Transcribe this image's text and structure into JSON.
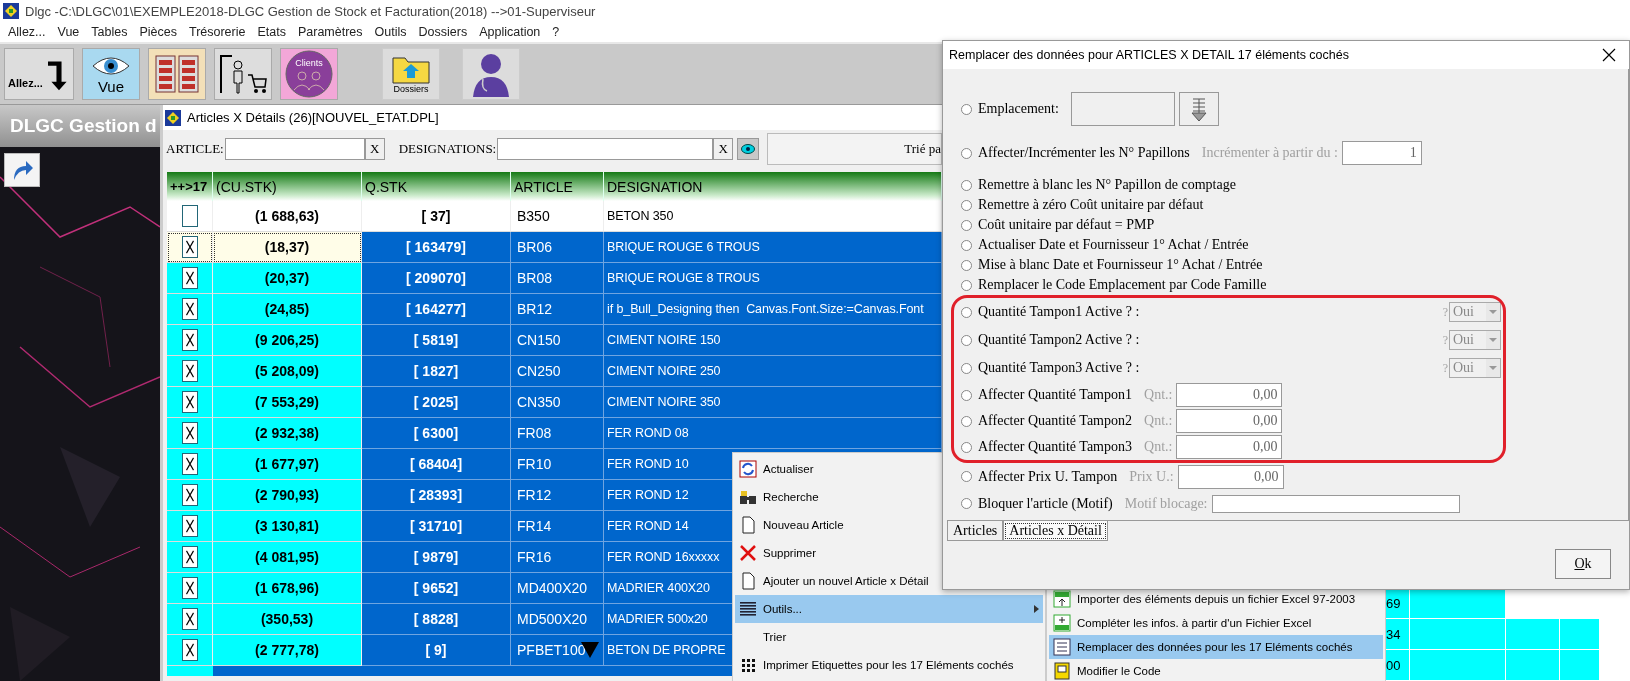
{
  "window": {
    "title": "Dlgc -C:\\DLGC\\01\\EXEMPLE2018-DLGC Gestion de Stock et Facturation(2018) -->01-Superviseur"
  },
  "menu": [
    "Allez...",
    "Vue",
    "Tables",
    "Pièces",
    "Trésorerie",
    "Etats",
    "Paramètres",
    "Outils",
    "Dossiers",
    "Application",
    "?"
  ],
  "toolbar": [
    {
      "kind": "allez",
      "label": "Allez..."
    },
    {
      "kind": "vue",
      "label": "Vue"
    },
    {
      "kind": "tables"
    },
    {
      "kind": "stock"
    },
    {
      "kind": "clients",
      "label": "Clients"
    },
    {
      "kind": "dossiers",
      "label": "Dossiers"
    },
    {
      "kind": "user"
    }
  ],
  "side_panel": {
    "title": "DLGC Gestion d"
  },
  "articles_window": {
    "title": "Articles X Détails (26)[NOUVEL_ETAT.DPL]",
    "filters": [
      {
        "label": "ARTICLE:",
        "clear": "X"
      },
      {
        "label": "DESIGNATIONS:",
        "clear": "X"
      }
    ],
    "sort_button": "Trié pa",
    "columns": [
      "++>17",
      "(CU.STK)",
      "Q.STK",
      "ARTICLE",
      "DESIGNATION"
    ],
    "rows": [
      {
        "checked": false,
        "focused": false,
        "cost": "(1 688,63)",
        "qty": "[ 37]",
        "article": "B350",
        "designation": "BETON 350"
      },
      {
        "checked": true,
        "focused": true,
        "cost": "(18,37)",
        "qty": "[ 163479]",
        "article": "BR06",
        "designation": "BRIQUE ROUGE 6 TROUS"
      },
      {
        "checked": true,
        "focused": false,
        "cost": "(20,37)",
        "qty": "[ 209070]",
        "article": "BR08",
        "designation": "BRIQUE ROUGE 8 TROUS"
      },
      {
        "checked": true,
        "focused": false,
        "cost": "(24,85)",
        "qty": "[ 164277]",
        "article": "BR12",
        "designation": "if b_Bull_Designing then  Canvas.Font.Size:=Canvas.Font"
      },
      {
        "checked": true,
        "focused": false,
        "cost": "(9 206,25)",
        "qty": "[ 5819]",
        "article": "CN150",
        "designation": "CIMENT NOIRE 150"
      },
      {
        "checked": true,
        "focused": false,
        "cost": "(5 208,09)",
        "qty": "[ 1827]",
        "article": "CN250",
        "designation": "CIMENT NOIRE 250"
      },
      {
        "checked": true,
        "focused": false,
        "cost": "(7 553,29)",
        "qty": "[ 2025]",
        "article": "CN350",
        "designation": "CIMENT NOIRE 350"
      },
      {
        "checked": true,
        "focused": false,
        "cost": "(2 932,38)",
        "qty": "[ 6300]",
        "article": "FR08",
        "designation": "FER ROND 08"
      },
      {
        "checked": true,
        "focused": false,
        "cost": "(1 677,97)",
        "qty": "[ 68404]",
        "article": "FR10",
        "designation": "FER ROND 10"
      },
      {
        "checked": true,
        "focused": false,
        "cost": "(2 790,93)",
        "qty": "[ 28393]",
        "article": "FR12",
        "designation": "FER ROND 12"
      },
      {
        "checked": true,
        "focused": false,
        "cost": "(3 130,81)",
        "qty": "[ 31710]",
        "article": "FR14",
        "designation": "FER ROND 14"
      },
      {
        "checked": true,
        "focused": false,
        "cost": "(4 081,95)",
        "qty": "[ 9879]",
        "article": "FR16",
        "designation": "FER ROND 16xxxxx"
      },
      {
        "checked": true,
        "focused": false,
        "cost": "(1 678,96)",
        "qty": "[ 9652]",
        "article": "MD400X20",
        "designation": "MADRIER 400X20"
      },
      {
        "checked": true,
        "focused": false,
        "cost": "(350,53)",
        "qty": "[ 8828]",
        "article": "MD500X20",
        "designation": "MADRIER 500x20"
      },
      {
        "checked": true,
        "focused": false,
        "cost": "(2 777,78)",
        "qty": "[ 9]",
        "article": "PFBET100",
        "designation": "BETON DE PROPRE",
        "marker": true
      }
    ]
  },
  "context_menu": [
    {
      "kind": "refresh",
      "label": "Actualiser",
      "selected": false
    },
    {
      "kind": "search",
      "label": "Recherche",
      "selected": false
    },
    {
      "kind": "document",
      "label": "Nouveau Article",
      "selected": false
    },
    {
      "kind": "delete",
      "label": "Supprimer",
      "selected": false
    },
    {
      "kind": "document",
      "label": "Ajouter un nouvel Article x Détail",
      "selected": false
    },
    {
      "kind": "list",
      "label": "Outils...",
      "selected": true,
      "submenu": true
    },
    {
      "kind": "none",
      "label": "Trier",
      "selected": false
    },
    {
      "kind": "grid",
      "label": "Imprimer Etiquettes pour les 17 Eléments cochés",
      "selected": false
    }
  ],
  "submenu": [
    {
      "kind": "excel-import",
      "label": "Importer des éléments depuis un fichier Excel 97-2003",
      "selected": false
    },
    {
      "kind": "excel-add",
      "label": "Compléter les infos. à partir d'un Fichier Excel",
      "selected": false
    },
    {
      "kind": "replace",
      "label": "Remplacer des données pour les 17 Eléments cochés",
      "selected": true
    },
    {
      "kind": "code",
      "label": "Modifier le Code",
      "selected": false
    }
  ],
  "background_grid": [
    "69",
    "34",
    "00"
  ],
  "dialog": {
    "title": "Remplacer des données pour ARTICLES X DETAIL 17 éléments cochés",
    "options": [
      {
        "kind": "location",
        "label": "Emplacement:",
        "selected": false
      },
      {
        "kind": "input",
        "label": "Affecter/Incrémenter les N° Papillons",
        "hint": "Incrémenter à partir du :",
        "value": "1",
        "selected": false
      },
      {
        "kind": "plain",
        "label": "Remettre à blanc les N° Papillon de comptage",
        "selected": false
      },
      {
        "kind": "plain",
        "label": "Remettre à zéro Coût unitaire par défaut",
        "selected": false
      },
      {
        "kind": "plain",
        "label": "Coût unitaire par défaut =  PMP",
        "selected": false
      },
      {
        "kind": "plain",
        "label": "Actualiser Date et Fournisseur 1° Achat / Entrée",
        "selected": false
      },
      {
        "kind": "plain",
        "label": "Mise à blanc Date et Fournisseur 1° Achat / Entrée",
        "selected": false
      },
      {
        "kind": "plain",
        "label": "Remplacer le Code Emplacement par Code Famille",
        "selected": false
      }
    ],
    "framed_options": [
      {
        "kind": "combo",
        "label": "Quantité Tampon1 Active ? :",
        "hint": "?",
        "value": "Oui",
        "selected": false
      },
      {
        "kind": "combo",
        "label": "Quantité Tampon2 Active ? :",
        "hint": "?",
        "value": "Oui",
        "selected": false
      },
      {
        "kind": "combo",
        "label": "Quantité Tampon3 Active ? :",
        "hint": "?",
        "value": "Oui",
        "selected": false
      },
      {
        "kind": "input",
        "label": "Affecter Quantité Tampon1",
        "hint": "Qnt.:",
        "value": "0,00",
        "selected": false
      },
      {
        "kind": "input",
        "label": "Affecter Quantité Tampon2",
        "hint": "Qnt.:",
        "value": "0,00",
        "selected": false
      },
      {
        "kind": "input",
        "label": "Affecter Quantité Tampon3",
        "hint": "Qnt.:",
        "value": "0,00",
        "selected": false
      }
    ],
    "more_options": [
      {
        "kind": "input",
        "label": "Affecter Prix U. Tampon",
        "hint": "Prix U.:",
        "value": "0,00",
        "selected": false
      },
      {
        "kind": "wide",
        "label": "Bloquer l'article (Motif)",
        "hint": "Motif blocage:",
        "selected": false
      }
    ],
    "tabs": [
      {
        "label": "Articles",
        "selected": false
      },
      {
        "label": "Articles x Détail",
        "selected": true
      }
    ],
    "ok_button": "Ok"
  }
}
